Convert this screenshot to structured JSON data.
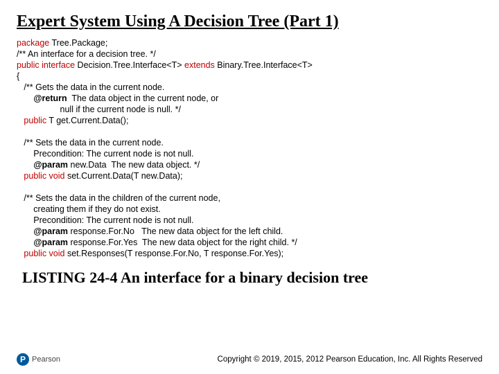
{
  "title": "Expert System Using A Decision Tree (Part 1)",
  "code": {
    "l1a": "package",
    "l1b": " Tree.Package;",
    "l2": "/** An interface for a decision tree. */",
    "l3a": "public interface",
    "l3b": " Decision.Tree.Interface<T> ",
    "l3c": "extends",
    "l3d": " Binary.Tree.Interface<T>",
    "l4": "{",
    "l5": "   /** Gets the data in the current node.",
    "l6a": "       ",
    "l6b": "@return",
    "l6c": "  The data object in the current node, or",
    "l7": "                  null if the current node is null. */",
    "l8a": "   public",
    "l8b": " T get.Current.Data();",
    "l10": "   /** Sets the data in the current node.",
    "l11": "       Precondition: The current node is not null.",
    "l12a": "       ",
    "l12b": "@param",
    "l12c": " new.Data  The new data object. */",
    "l13a": "   public void",
    "l13b": " set.Current.Data(T new.Data);",
    "l15": "   /** Sets the data in the children of the current node,",
    "l16": "       creating them if they do not exist.",
    "l17": "       Precondition: The current node is not null.",
    "l18a": "       ",
    "l18b": "@param",
    "l18c": " response.For.No   The new data object for the left child.",
    "l19a": "       ",
    "l19b": "@param",
    "l19c": " response.For.Yes  The new data object for the right child. */",
    "l20a": "   public void",
    "l20b": " set.Responses(T response.For.No, T response.For.Yes);"
  },
  "listing": "LISTING 24-4 An interface for a binary decision tree",
  "brand": "Pearson",
  "logo_letter": "P",
  "copyright": "Copyright © 2019, 2015, 2012 Pearson Education, Inc. All Rights Reserved"
}
